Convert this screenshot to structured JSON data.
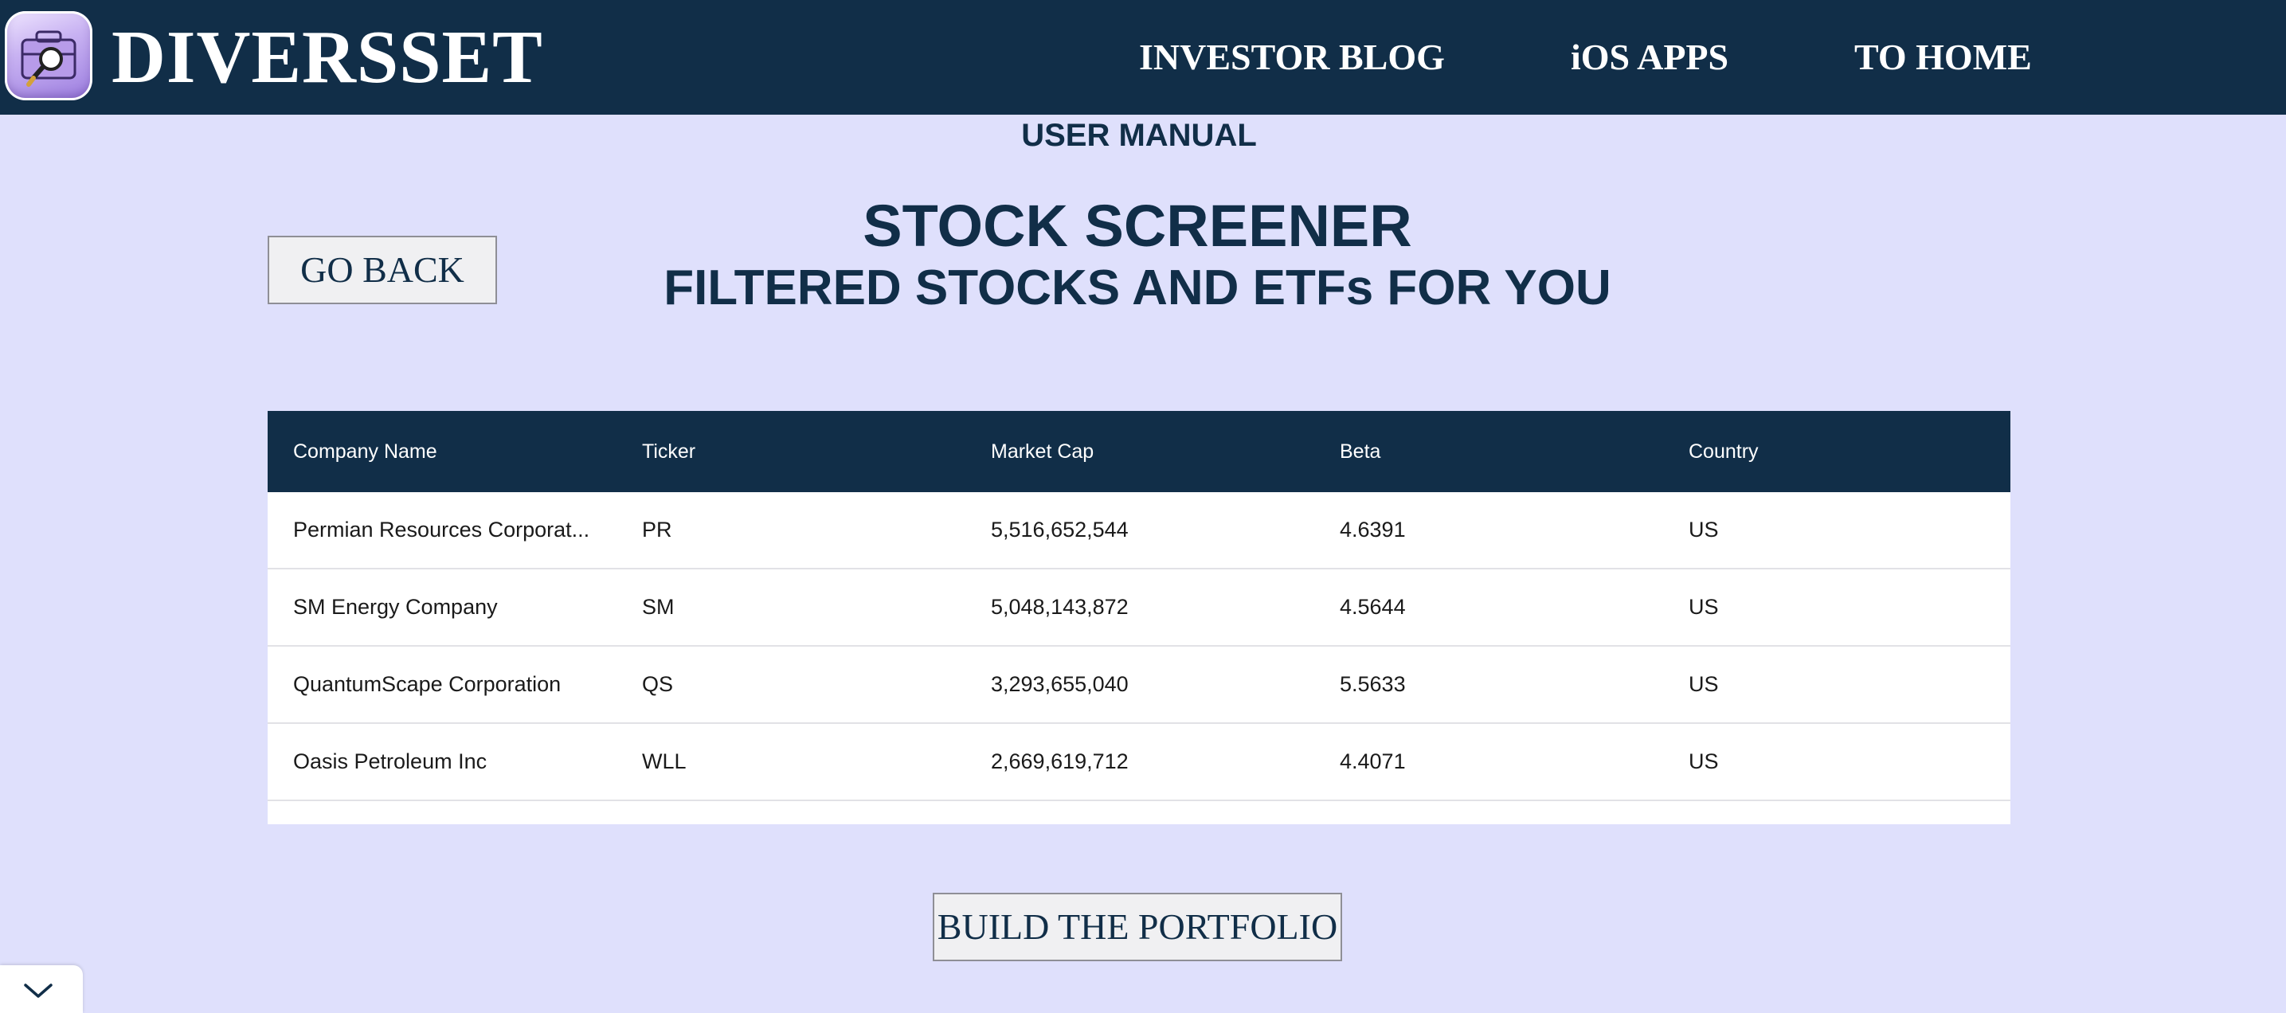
{
  "header": {
    "brand": "DIVERSSET",
    "nav": {
      "blog": "INVESTOR BLOG",
      "ios": "iOS APPS",
      "home": "TO HOME"
    }
  },
  "main": {
    "manual_link": "USER MANUAL",
    "title": "STOCK SCREENER",
    "subtitle": "FILTERED STOCKS AND ETFs FOR YOU",
    "go_back_label": "GO BACK",
    "build_label": "BUILD THE PORTFOLIO"
  },
  "table": {
    "headers": [
      "Company Name",
      "Ticker",
      "Market Cap",
      "Beta",
      "Country"
    ],
    "rows": [
      [
        "Permian Resources Corporat...",
        "PR",
        "5,516,652,544",
        "4.6391",
        "US"
      ],
      [
        "SM Energy Company",
        "SM",
        "5,048,143,872",
        "4.5644",
        "US"
      ],
      [
        "QuantumScape Corporation",
        "QS",
        "3,293,655,040",
        "5.5633",
        "US"
      ],
      [
        "Oasis Petroleum Inc",
        "WLL",
        "2,669,619,712",
        "4.4071",
        "US"
      ]
    ]
  },
  "icons": {
    "logo": "briefcase-magnifier-icon",
    "corner": "chevron-down-icon"
  },
  "colors": {
    "navy": "#112e48",
    "background": "#dfe0fc"
  }
}
